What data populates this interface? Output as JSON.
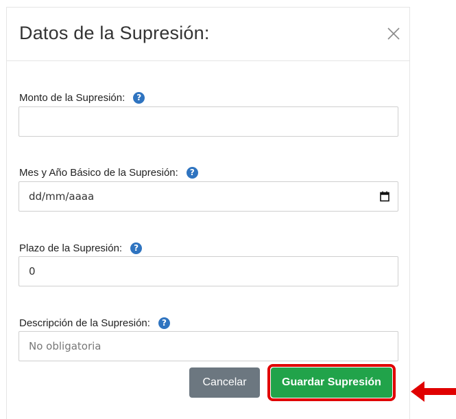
{
  "dialog": {
    "title": "Datos de la Supresión:",
    "close_icon": "close-icon"
  },
  "fields": {
    "monto": {
      "label": "Monto de la Supresión:",
      "value": "",
      "help_icon": "help-icon"
    },
    "mes_anio": {
      "label": "Mes y Año Básico de la Supresión:",
      "value": "dd/mm/aaaa",
      "help_icon": "help-icon",
      "picker_icon": "calendar-icon"
    },
    "plazo": {
      "label": "Plazo de la Supresión:",
      "value": "0",
      "help_icon": "help-icon"
    },
    "descripcion": {
      "label": "Descripción de la Supresión:",
      "placeholder": "No obligatoria",
      "value": "",
      "help_icon": "help-icon"
    }
  },
  "buttons": {
    "cancel_label": "Cancelar",
    "save_label": "Guardar Supresión"
  },
  "colors": {
    "help_icon": "#2f74c0",
    "cancel_button": "#6c7780",
    "save_button": "#21a34a",
    "highlight": "#e00000"
  },
  "help_glyph": "?"
}
